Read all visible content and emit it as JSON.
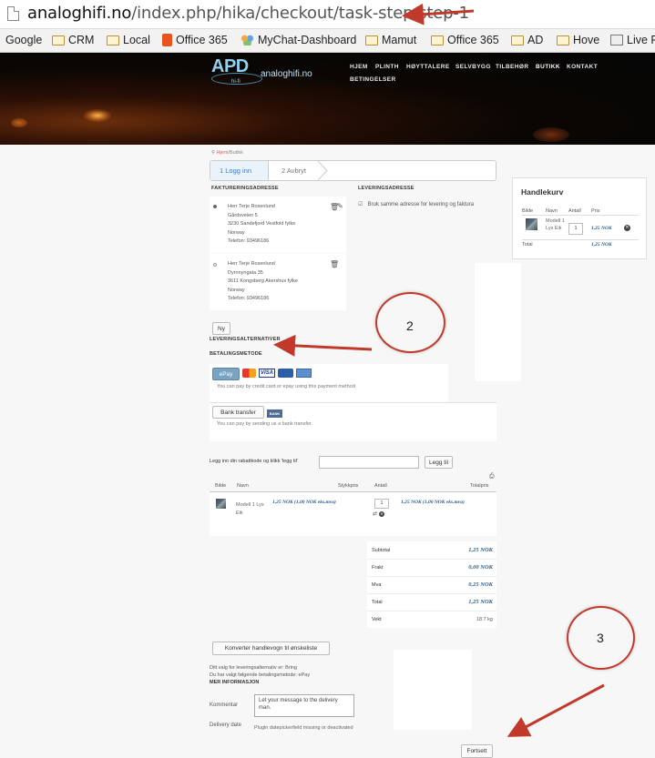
{
  "browser": {
    "url_host": "analoghifi.no",
    "url_path": "/index.php/hika/checkout/task-step/step-1",
    "bookmarks": [
      {
        "label": "Google",
        "icon": "none"
      },
      {
        "label": "CRM",
        "icon": "folder-icon"
      },
      {
        "label": "Local",
        "icon": "folder-icon"
      },
      {
        "label": "Office 365",
        "icon": "office365-icon"
      },
      {
        "label": "MyChat-Dashboard",
        "icon": "people-icon"
      },
      {
        "label": "Mamut",
        "icon": "folder-icon"
      },
      {
        "label": "Office 365",
        "icon": "folder-icon"
      },
      {
        "label": "AD",
        "icon": "folder-icon"
      },
      {
        "label": "Hove",
        "icon": "folder-icon"
      },
      {
        "label": "Live F",
        "icon": "badge-icon"
      }
    ]
  },
  "site": {
    "logo_main": "APD",
    "logo_sub": "hi-fi",
    "logo_name": "analoghifi.no",
    "nav": [
      "HJEM",
      "PLINTH",
      "HØYTTALERE",
      "SELVBYGG",
      "TILBEHØR",
      "BUTIKK",
      "KONTAKT",
      "BETINGELSER"
    ],
    "nav_active": "BUTIKK"
  },
  "breadcrumb": {
    "home": "Hjem",
    "separator": "/",
    "current": "Butikk"
  },
  "steps": {
    "step1": "1  Logg inn",
    "step2": "2  Avbryt"
  },
  "billing": {
    "heading": "FAKTURERINGSADRESSE",
    "addresses": [
      {
        "lines": [
          "Herr Terje Rosenlund",
          "Gårdsveien 5",
          "3230 Sandefjord Vestfold fylke",
          "Norway",
          "Telefon: 93496186"
        ]
      },
      {
        "lines": [
          "Herr Terje Rosenlund",
          "Dyrnnyngata 35",
          "3611 Kongsberg Akershus fylke",
          "Norway",
          "Telefon: 93496186"
        ]
      }
    ],
    "new_button": "Ny"
  },
  "shipping": {
    "heading": "LEVERINGSADRESSE",
    "same_address_label": "Bruk samme adresse for levering og faktura"
  },
  "cart_module": {
    "title": "Handlekurv",
    "headers": [
      "Bilde",
      "Navn",
      "Antall",
      "Pris"
    ],
    "item": {
      "name": "Modell 1 Lys Eik",
      "qty": "1",
      "price": "1,25 NOK"
    },
    "total_label": "Total",
    "total_value": "1,25 NOK"
  },
  "shipping_options_heading": "LEVERINGSALTERNATIVER",
  "payment": {
    "heading": "BETALINGSMETODE",
    "methods": [
      {
        "button": "ePay",
        "description": "You can pay by credit card or epay using this payment method"
      },
      {
        "button": "Bank transfer",
        "badge": "BANK",
        "description": "You can pay by sending us a bank transfer."
      }
    ]
  },
  "coupon": {
    "label": "Legg inn din rabattkode og klikk 'legg til'",
    "value": "",
    "button": "Legg til"
  },
  "cart_table": {
    "headers": [
      "Bilde",
      "Navn",
      "Stykkpris",
      "Antall",
      "Totalpris"
    ],
    "row": {
      "name": "Modell 1 Lys Eik",
      "unit_price": "1,25 NOK (1,00 NOK eks.mva)",
      "qty": "1",
      "total_price": "1,25 NOK (1,00 NOK eks.mva)"
    }
  },
  "totals": [
    {
      "label": "Subtotal",
      "value": "1,25 NOK",
      "style": "price"
    },
    {
      "label": "Frakt",
      "value": "0,00 NOK",
      "style": "price"
    },
    {
      "label": "Mva",
      "value": "0,25 NOK",
      "style": "price"
    },
    {
      "label": "Total",
      "value": "1,25 NOK",
      "style": "price"
    },
    {
      "label": "Vekt",
      "value": "18.7 kg",
      "style": "plain"
    }
  ],
  "convert_button": "Konverter handlevogn til ønskeliste",
  "summary": {
    "shipping_choice": "Ditt valg for leveringsalternativ er: Bring",
    "payment_choice": "Du har valgt følgende betalingsmetode: ePay",
    "more_info": "MER INFORMASJON"
  },
  "comment": {
    "label": "Kommentar",
    "value": "Let your message to the delivery man."
  },
  "delivery_date": {
    "label": "Delivery date",
    "note": "Plugin datepickerfield missing or deactivated"
  },
  "continue_button": "Fortsett",
  "annotations": {
    "circle2": "2",
    "circle3": "3",
    "color": "#c0392b"
  }
}
